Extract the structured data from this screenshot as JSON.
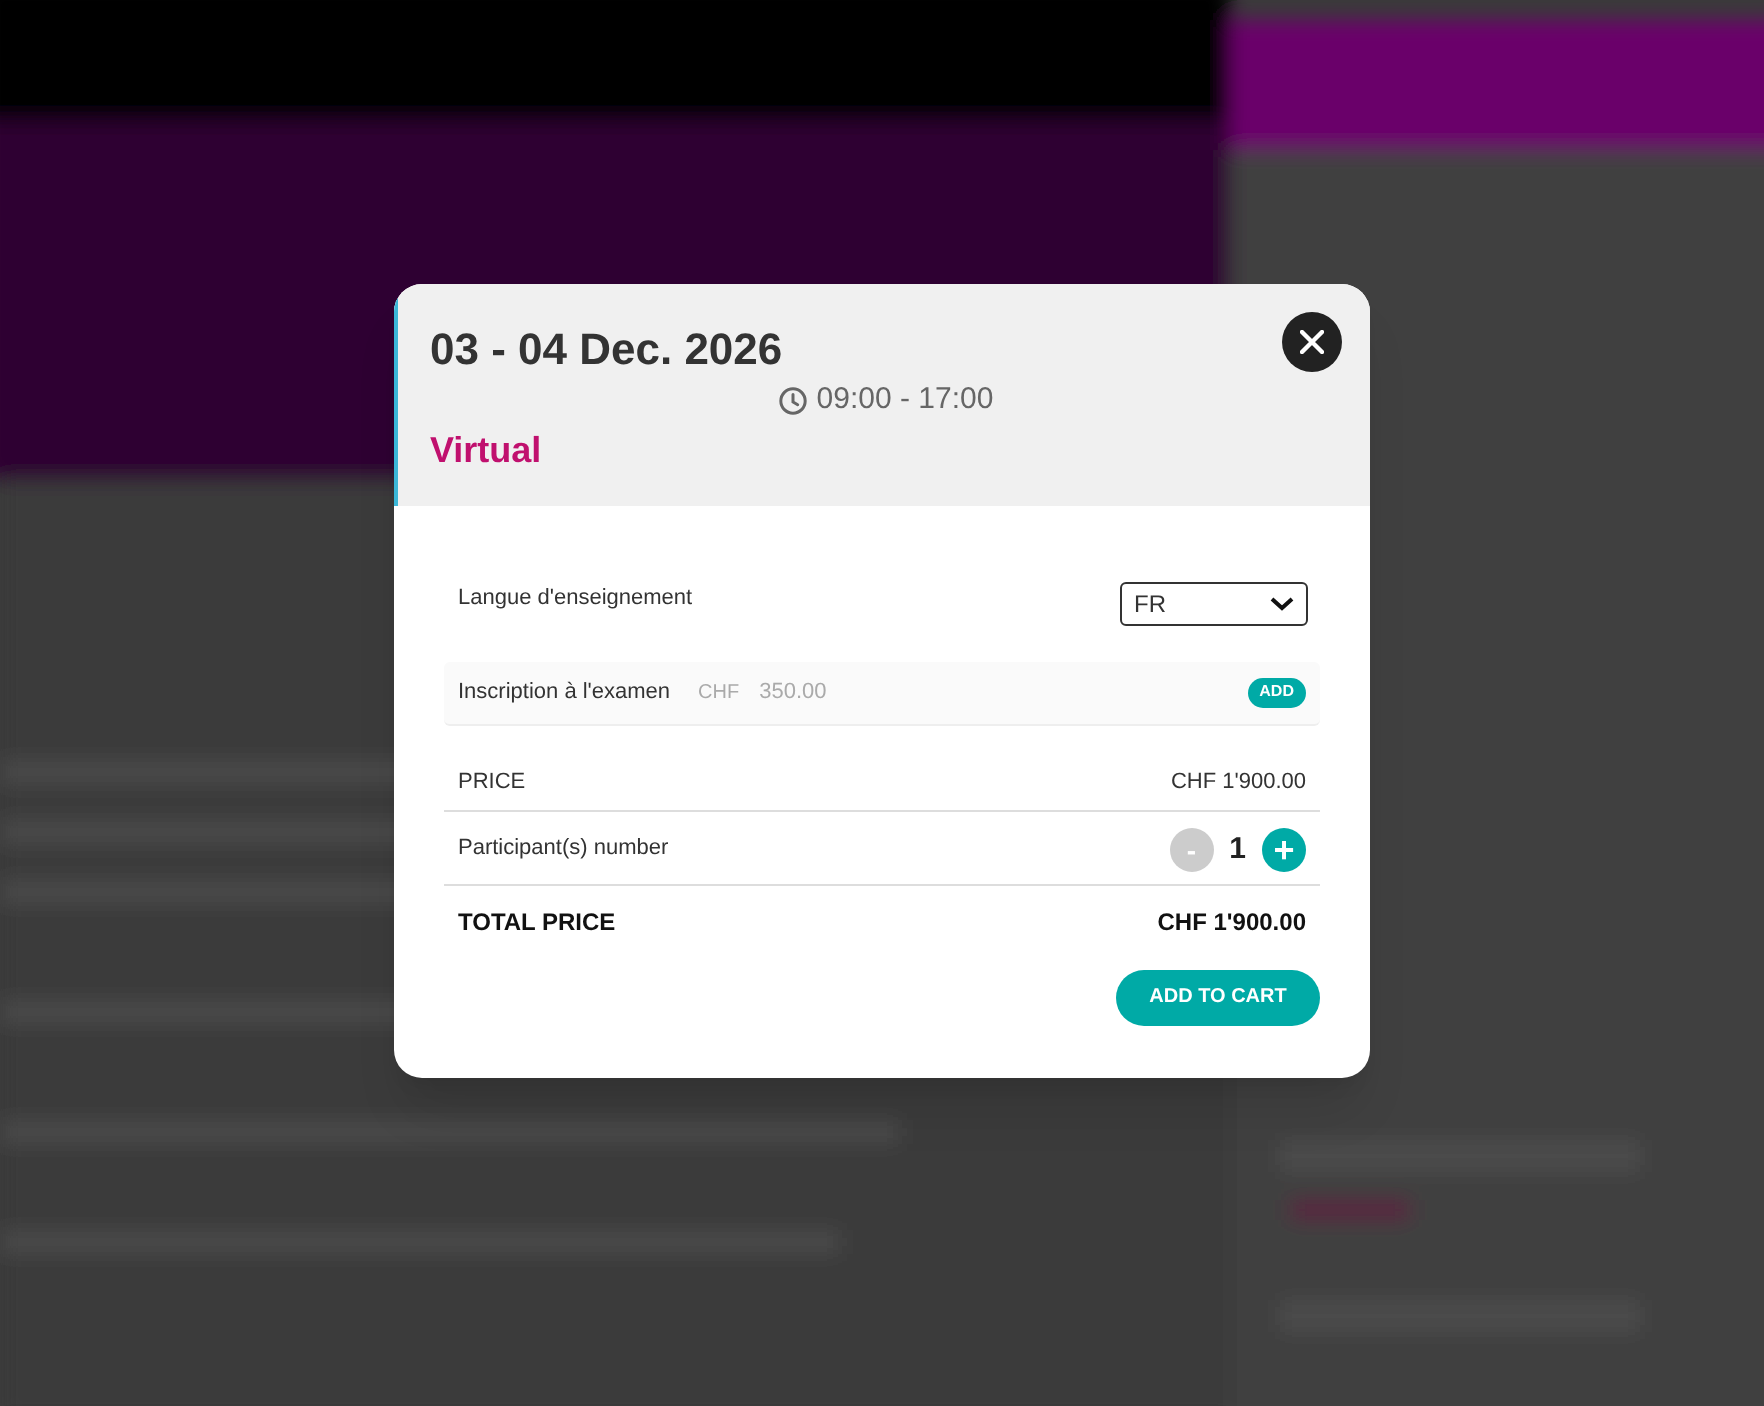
{
  "modal": {
    "date": "03 - 04 Dec. 2026",
    "time": "09:00 - 17:00",
    "format": "Virtual",
    "language": {
      "label": "Langue d'enseignement",
      "value": "FR"
    },
    "option": {
      "label": "Inscription à l'examen",
      "currency": "CHF",
      "amount": "350.00",
      "button": "ADD"
    },
    "price": {
      "label": "PRICE",
      "value": "CHF 1'900.00"
    },
    "participants": {
      "label": "Participant(s) number",
      "minus": "-",
      "count": "1",
      "plus": "+",
      "minus_disabled": true
    },
    "total": {
      "label": "TOTAL PRICE",
      "value": "CHF 1'900.00"
    },
    "add_to_cart": "ADD TO CART"
  }
}
